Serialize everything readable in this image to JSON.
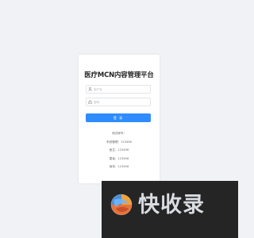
{
  "app": {
    "title": "医疗MCN内容管理平台"
  },
  "login_form": {
    "username_placeholder": "用户名",
    "password_placeholder": "密码",
    "login_label": "登 录"
  },
  "demo_accounts": {
    "heading": "测试帐号：",
    "lines": [
      "系统管理：123456",
      "医生：123456",
      "患者：123456",
      "商务：123456"
    ]
  },
  "watermark": {
    "text": "快收录",
    "logo_icon": "colorful-globe-logo"
  },
  "colors": {
    "background": "#f0f2f5",
    "primary": "#2f8cff",
    "card": "#ffffff"
  }
}
